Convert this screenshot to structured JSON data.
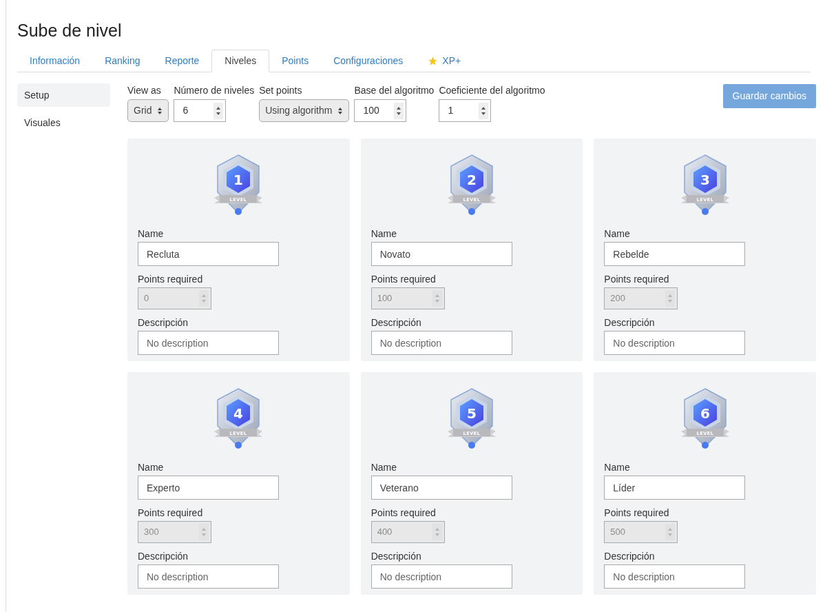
{
  "title": "Sube de nivel",
  "tabs": [
    {
      "label": "Información",
      "selected": false,
      "kind": "plain"
    },
    {
      "label": "Ranking",
      "selected": false,
      "kind": "plain"
    },
    {
      "label": "Reporte",
      "selected": false,
      "kind": "plain"
    },
    {
      "label": "Niveles",
      "selected": true,
      "kind": "plain"
    },
    {
      "label": "Points",
      "selected": false,
      "kind": "plain"
    },
    {
      "label": "Configuraciones",
      "selected": false,
      "kind": "plain"
    },
    {
      "label": "XP+",
      "selected": false,
      "kind": "star"
    }
  ],
  "sidebar": {
    "items": [
      {
        "label": "Setup",
        "selected": true
      },
      {
        "label": "Visuales",
        "selected": false
      }
    ]
  },
  "controls": [
    {
      "kind": "select",
      "label": "View as",
      "value": "Grid"
    },
    {
      "kind": "number",
      "label": "Número de niveles",
      "value": "6"
    },
    {
      "kind": "select",
      "label": "Set points",
      "value": "Using algorithm"
    },
    {
      "kind": "number",
      "label": "Base del algoritmo",
      "value": "100"
    },
    {
      "kind": "number",
      "label": "Coeficiente del algoritmo",
      "value": "1"
    }
  ],
  "save_button": "Guardar cambios",
  "levels": [
    {
      "badge_number": "1",
      "badge_label": "LEVEL",
      "name_label": "Name",
      "name": "Recluta",
      "points_label": "Points required",
      "points": "0",
      "points_disabled": true,
      "description_label": "Descripción",
      "description_placeholder": "No description"
    },
    {
      "badge_number": "2",
      "badge_label": "LEVEL",
      "name_label": "Name",
      "name": "Novato",
      "points_label": "Points required",
      "points": "100",
      "points_disabled": true,
      "description_label": "Descripción",
      "description_placeholder": "No description"
    },
    {
      "badge_number": "3",
      "badge_label": "LEVEL",
      "name_label": "Name",
      "name": "Rebelde",
      "points_label": "Points required",
      "points": "200",
      "points_disabled": true,
      "description_label": "Descripción",
      "description_placeholder": "No description"
    },
    {
      "badge_number": "4",
      "badge_label": "LEVEL",
      "name_label": "Name",
      "name": "Experto",
      "points_label": "Points required",
      "points": "300",
      "points_disabled": true,
      "description_label": "Descripción",
      "description_placeholder": "No description"
    },
    {
      "badge_number": "5",
      "badge_label": "LEVEL",
      "name_label": "Name",
      "name": "Veterano",
      "points_label": "Points required",
      "points": "400",
      "points_disabled": true,
      "description_label": "Descripción",
      "description_placeholder": "No description"
    },
    {
      "badge_number": "6",
      "badge_label": "LEVEL",
      "name_label": "Name",
      "name": "Líder",
      "points_label": "Points required",
      "points": "500",
      "points_disabled": true,
      "description_label": "Descripción",
      "description_placeholder": "No description"
    }
  ]
}
